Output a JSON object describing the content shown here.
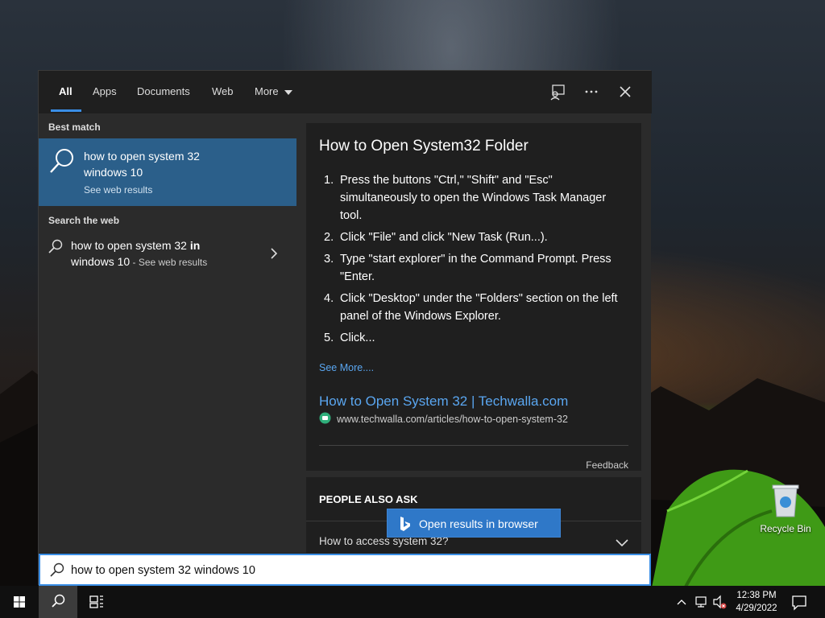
{
  "desktop": {
    "recycle_bin_label": "Recycle Bin"
  },
  "search_panel": {
    "tabs": [
      {
        "label": "All",
        "active": true
      },
      {
        "label": "Apps",
        "active": false
      },
      {
        "label": "Documents",
        "active": false
      },
      {
        "label": "Web",
        "active": false
      },
      {
        "label": "More",
        "active": false
      }
    ],
    "toolbar_icons": [
      "feedback-icon",
      "more-options-icon",
      "close-icon"
    ],
    "best_match": {
      "section_label": "Best match",
      "title": "how to open system 32 windows 10",
      "subtitle": "See web results"
    },
    "search_web": {
      "section_label": "Search the web",
      "line1_normal": "how to open system 32 ",
      "line1_bold": "in",
      "line2_normal": "windows 10",
      "line2_dim": " - See web results"
    },
    "preview": {
      "title": "How to Open System32 Folder",
      "steps": [
        {
          "num": "1.",
          "text": "Press the buttons \"Ctrl,\" \"Shift\" and \"Esc\" simultaneously to open the Windows Task Manager tool."
        },
        {
          "num": "2.",
          "text": "Click \"File\" and click \"New Task (Run...)."
        },
        {
          "num": "3.",
          "text": "Type \"start explorer\" in the Command Prompt. Press \"Enter."
        },
        {
          "num": "4.",
          "text": "Click \"Desktop\" under the \"Folders\" section on the left panel of the Windows Explorer."
        },
        {
          "num": "5.",
          "text": "Click..."
        }
      ],
      "see_more": "See More....",
      "source_title": "How to Open System 32 | Techwalla.com",
      "source_url": "www.techwalla.com/articles/how-to-open-system-32",
      "feedback": "Feedback"
    },
    "people_also_ask": {
      "heading": "PEOPLE ALSO ASK",
      "question": "How to access system 32?"
    },
    "open_in_browser": "Open results in browser",
    "search_box": {
      "value": "how to open system 32 windows 10"
    }
  },
  "taskbar": {
    "time": "12:38 PM",
    "date": "4/29/2022"
  },
  "colors": {
    "accent": "#3a8ee6",
    "selected_result": "#2b5f8a",
    "link": "#5aa6f0",
    "open_browser_button": "#2f78c8"
  }
}
